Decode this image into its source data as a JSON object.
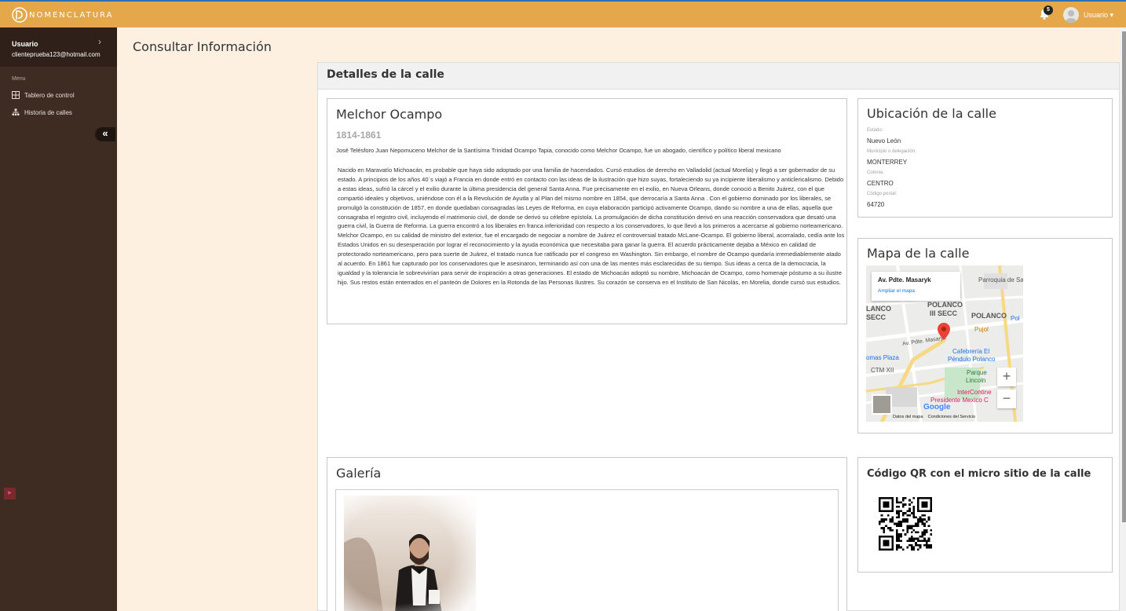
{
  "app": {
    "brand": "NOMENCLATURA",
    "notifications_count": "5",
    "user_menu_label": "Usuario"
  },
  "sidebar": {
    "user_name": "Usuario",
    "user_email": "clienteprueba123@hotmail.com",
    "menu_label": "Menu",
    "items": [
      {
        "label": "Tablero de control",
        "icon": "grid-icon"
      },
      {
        "label": "Historia de calles",
        "icon": "sitemap-icon"
      }
    ],
    "collapse_glyph": "«"
  },
  "page": {
    "title": "Consultar Información",
    "panel_title": "Detalles de la calle"
  },
  "person": {
    "name": "Melchor Ocampo",
    "years": "1814-1861",
    "full_name": "José Telésforo Juan Nepomuceno Melchor de la Santísima Trinidad Ocampo Tapia, conocido como Melchor Ocampo, fue un abogado, científico y político liberal mexicano",
    "bio": "Nacido en Maravatío Michoacán, es probable que haya sido adoptado por una familia de hacendados. Cursó estudios de derecho en Valladolid (actual Morelia) y llegó a ser gobernador de su estado. A principios de los años 40´s viajó a Francia en donde entró en contacto con las ideas de la ilustración que hizo suyas, fortaleciendo su ya incipiente liberalismo y anticlericalismo. Debido a estas ideas, sufrió la cárcel y el exilio durante la última presidencia del general Santa Anna. Fue precisamente en el exilio, en Nueva Orleans, donde conoció a Benito Juárez, con el que compartió ideales y objetivos, uniéndose con él a la Revolución de Ayutla y al Plan del mismo nombre en 1854, que derrocaría a Santa Anna . Con el gobierno dominado por los liberales, se promulgó la constitución de 1857, en donde quedaban consagradas las Leyes de Reforma, en cuya elaboración participó activamente Ocampo, dando su nombre a una de ellas, aquella que consagraba el registro civil, incluyendo el matrimonio civil, de donde se derivó su célebre epístola. La promulgación de dicha constitución derivó en una reacción conservadora que desató una guerra civil, la Guerra de Reforma. La guerra encontró a los liberales en franca inferioridad con respecto a los conservadores, lo que llevó a los primeros a acercarse al gobierno norteamericano. Melchor Ocampo, en su calidad de ministro del exterior, fue el encargado de negociar a nombre de Juárez el controversial tratado McLane-Ocampo. El gobierno liberal, acorralado, cedía ante los Estados Unidos en su desesperación por lograr el reconocimiento y la ayuda económica que necesitaba para ganar la guerra. El acuerdo prácticamente dejaba a México en calidad de protectorado norteamericano, pero para suerte de Juárez, el tratado nunca fue ratificado por el congreso en Washington. Sin embargo, el nombre de Ocampo quedaría irremediablemente atado al acuerdo. En 1861 fue capturado por los conservadores que le asesinaron, terminando así con una de las mentes más esclarecidas de su tiempo. Sus ideas a cerca de la democracia, la igualdad y la tolerancia le sobrevivirían para servir de inspiración a otras generaciones. El estado de Michoacán adoptó su nombre, Michoacán de Ocampo, como homenaje póstumo a su ilustre hijo. Sus restos están enterrados en el panteón de Dolores en la Rotonda de las Personas Ilustres. Su corazón se conserva en el Instituto de San Nicolás, en Morelia, donde cursó sus estudios."
  },
  "location": {
    "title": "Ubicación de la calle",
    "fields": [
      {
        "label": "Estado:",
        "value": "Nuevo León"
      },
      {
        "label": "Municipio o delegación:",
        "value": "MONTERREY"
      },
      {
        "label": "Colonia:",
        "value": "CENTRO"
      },
      {
        "label": "Código postal:",
        "value": "64720"
      }
    ]
  },
  "map": {
    "title": "Mapa de la calle",
    "popup_title": "Av. Pdte. Masaryk",
    "popup_link": "Ampliar el mapa",
    "labels": {
      "parroquia": "Parroquia de San",
      "polanco3": "POLANCO",
      "polanco3b": "III SECC",
      "lanco": "LANCO",
      "secc": "SECC",
      "polanco": "POLANCO",
      "pol": "Pol",
      "pujol": "Pujol",
      "street": "Av. Pdte. Masaryk",
      "cafe1": "Cafebrería El",
      "cafe2": "Péndulo Polanco",
      "omas": "omas Plaza",
      "ctm": "CTM XII",
      "parque1": "Parque",
      "parque2": "Lincoln",
      "inter1": "InterContine",
      "inter2": "Presidente Mexico C",
      "google": "Google",
      "datos": "Datos del mapa",
      "condiciones": "Condiciones del Servicio"
    },
    "zoom_in": "+",
    "zoom_out": "−"
  },
  "gallery": {
    "title": "Galería"
  },
  "qr": {
    "title": "Código QR con el micro sitio de la calle"
  },
  "colors": {
    "topbar": "#e4a84b",
    "sidebar": "#3e2c22",
    "page_bg": "#fdf0e1",
    "pin": "#ea4335"
  }
}
